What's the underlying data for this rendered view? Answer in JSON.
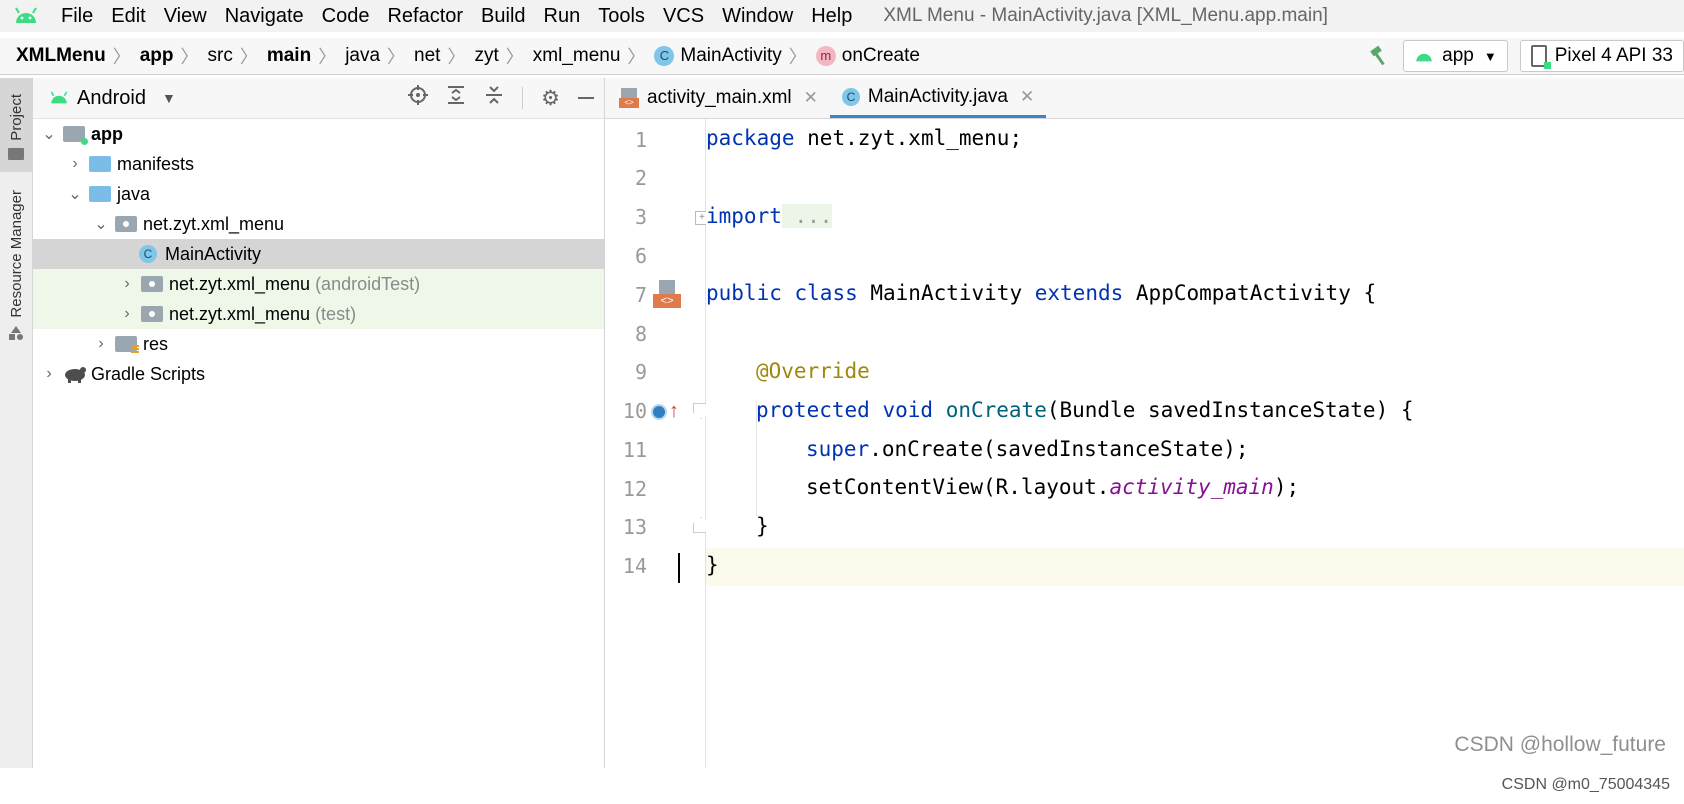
{
  "menubar": {
    "items": [
      "File",
      "Edit",
      "View",
      "Navigate",
      "Code",
      "Refactor",
      "Build",
      "Run",
      "Tools",
      "VCS",
      "Window",
      "Help"
    ],
    "window_title": "XML Menu - MainActivity.java [XML_Menu.app.main]"
  },
  "breadcrumb": {
    "items": [
      "XMLMenu",
      "app",
      "src",
      "main",
      "java",
      "net",
      "zyt",
      "xml_menu",
      "MainActivity",
      "onCreate"
    ]
  },
  "toolbar": {
    "run_config": "app",
    "device": "Pixel 4 API 33"
  },
  "left_strip": {
    "project_tab": "Project",
    "resource_tab": "Resource Manager"
  },
  "project_panel": {
    "view_mode": "Android",
    "tree": [
      {
        "label": "app",
        "suffix": ""
      },
      {
        "label": "manifests",
        "suffix": ""
      },
      {
        "label": "java",
        "suffix": ""
      },
      {
        "label": "net.zyt.xml_menu",
        "suffix": ""
      },
      {
        "label": "MainActivity",
        "suffix": ""
      },
      {
        "label": "net.zyt.xml_menu",
        "suffix": "(androidTest)"
      },
      {
        "label": "net.zyt.xml_menu",
        "suffix": "(test)"
      },
      {
        "label": "res",
        "suffix": ""
      },
      {
        "label": "Gradle Scripts",
        "suffix": ""
      }
    ]
  },
  "editor": {
    "tabs": [
      "activity_main.xml",
      "MainActivity.java"
    ],
    "active_tab": "MainActivity.java",
    "line_numbers": [
      "1",
      "2",
      "3",
      "6",
      "7",
      "8",
      "9",
      "10",
      "11",
      "12",
      "13",
      "14"
    ],
    "code": {
      "l1_kw": "package",
      "l1_rest": " net.zyt.xml_menu;",
      "l3_kw": "import",
      "l3_fold": " ...",
      "l7_kw1": "public",
      "l7_kw2": "class",
      "l7_name": " MainActivity ",
      "l7_kw3": "extends",
      "l7_rest": " AppCompatActivity {",
      "l9": "@Override",
      "l10_kw1": "protected",
      "l10_kw2": "void",
      "l10_fn": "onCreate",
      "l10_rest": "(Bundle savedInstanceState) {",
      "l11_kw": "super",
      "l11_rest": ".onCreate(savedInstanceState);",
      "l12_a": "setContentView(R.layout.",
      "l12_b": "activity_main",
      "l12_c": ");",
      "l13": "}",
      "l14": "}"
    }
  },
  "watermark": "CSDN @hollow_future",
  "footer_credit": "CSDN @m0_75004345",
  "colors": {
    "accent": "#4083c9",
    "keyword": "#0033b3",
    "annotation": "#9e880d",
    "android_green": "#3ddc84"
  }
}
